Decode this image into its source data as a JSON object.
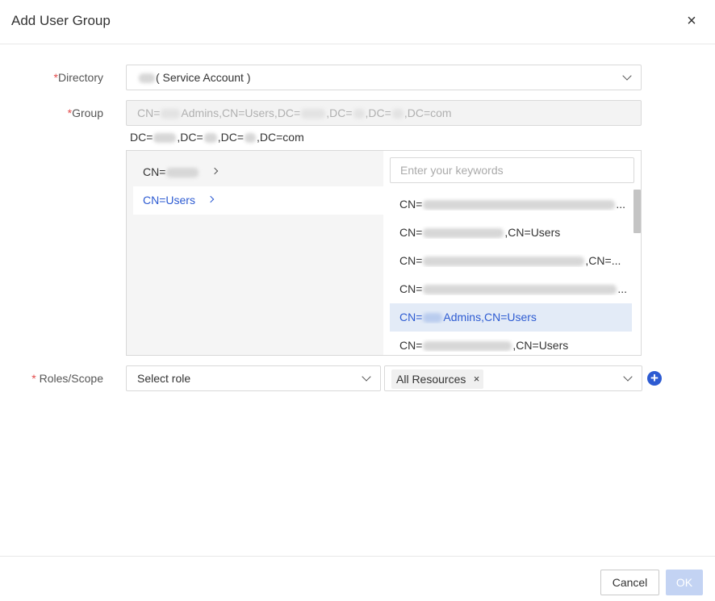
{
  "dialog": {
    "title": "Add User Group",
    "close_icon": "close-icon"
  },
  "form": {
    "directory": {
      "label_required": "*",
      "label": "Directory",
      "value": "( Service Account )"
    },
    "group": {
      "label_required": "*",
      "label": "Group",
      "value_parts": [
        "CN=",
        "Admins,CN=Users,DC=",
        ",DC=",
        ",DC=",
        ",DC=com"
      ]
    },
    "breadcrumb": {
      "parts": [
        "DC=",
        ",DC=",
        ",DC=",
        ",DC=com"
      ]
    },
    "tree": {
      "left_items": [
        {
          "prefix": "CN=",
          "suffix": "",
          "selected": false
        },
        {
          "prefix": "CN=Users",
          "suffix": "",
          "selected": true
        }
      ],
      "search_placeholder": "Enter your keywords",
      "right_items": [
        {
          "prefix": "CN=",
          "suffix": "...",
          "highlight": false
        },
        {
          "prefix": "CN=",
          "suffix": ",CN=Users",
          "highlight": false
        },
        {
          "prefix": "CN=",
          "suffix": ",CN=...",
          "highlight": false
        },
        {
          "prefix": "CN=",
          "suffix": "...",
          "highlight": false
        },
        {
          "prefix": "CN=",
          "suffix": "Admins,CN=Users",
          "highlight": true
        },
        {
          "prefix": "CN=",
          "suffix": ",CN=Users",
          "highlight": false
        }
      ]
    },
    "roles_scope": {
      "label_required": "* ",
      "label": "Roles/Scope",
      "role_value": "Select role",
      "scope_tag": "All Resources",
      "scope_tag_close": "×",
      "add_icon": "plus-circle-icon"
    }
  },
  "footer": {
    "cancel_label": "Cancel",
    "ok_label": "OK"
  },
  "colors": {
    "accent": "#2d5bd2",
    "highlight_bg": "#e3ebf7",
    "required": "#e24a4a",
    "ok_disabled": "#c3d3f3"
  }
}
